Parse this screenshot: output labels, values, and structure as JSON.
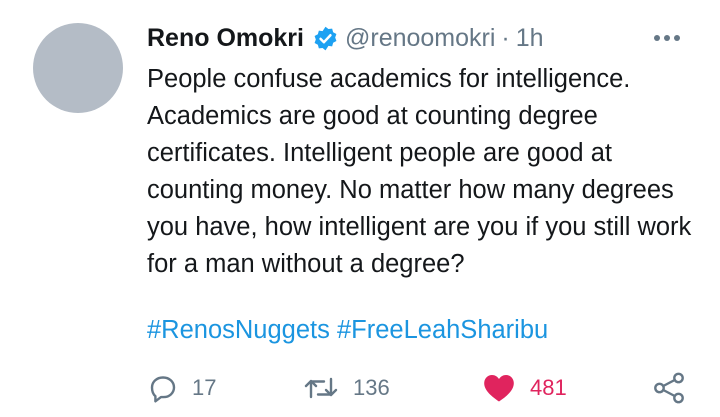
{
  "tweet": {
    "author_name": "Reno Omokri",
    "handle": "@renoomokri",
    "separator": "·",
    "time": "1h",
    "text": "People confuse academics for intelligence. Academics are good at counting degree certificates. Intelligent people are good at counting money. No matter how many degrees you have, how intelligent are you if you still work for a man without a degree?",
    "hashtags": [
      "#RenosNuggets",
      "#FreeLeahSharibu"
    ],
    "replies": "17",
    "retweets": "136",
    "likes": "481",
    "liked": true
  },
  "icons": {
    "verified": "verified-badge-icon",
    "more": "more-options-icon",
    "reply": "reply-icon",
    "retweet": "retweet-icon",
    "like": "heart-icon",
    "share": "share-icon"
  },
  "colors": {
    "text": "#14171a",
    "secondary": "#657786",
    "link": "#1b95e0",
    "like": "#e0245e",
    "verified": "#1da1f2",
    "avatar": "#b4bcc6"
  }
}
